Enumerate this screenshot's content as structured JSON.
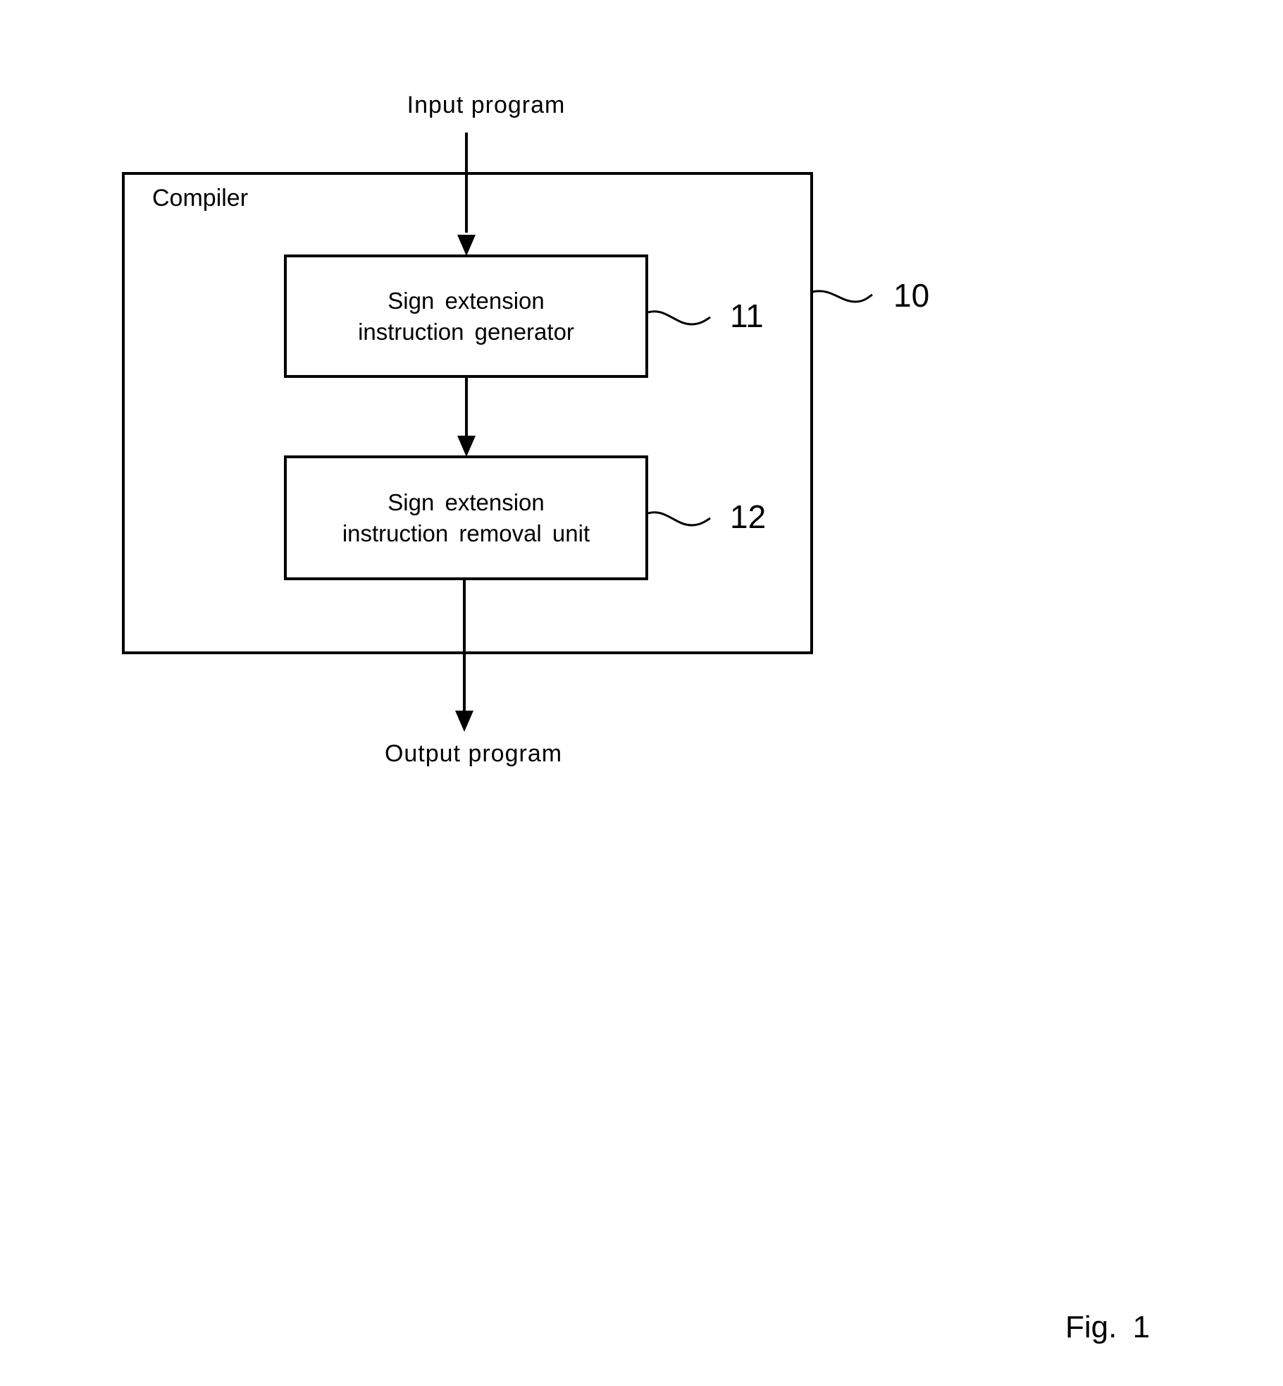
{
  "diagram": {
    "input_label": "Input program",
    "output_label": "Output program",
    "container": {
      "label": "Compiler",
      "ref": "10"
    },
    "blocks": [
      {
        "lines": [
          "Sign extension",
          "instruction generator"
        ],
        "ref": "11"
      },
      {
        "lines": [
          "Sign extension",
          "instruction removal unit"
        ],
        "ref": "12"
      }
    ],
    "figure_label": "Fig. 1"
  }
}
